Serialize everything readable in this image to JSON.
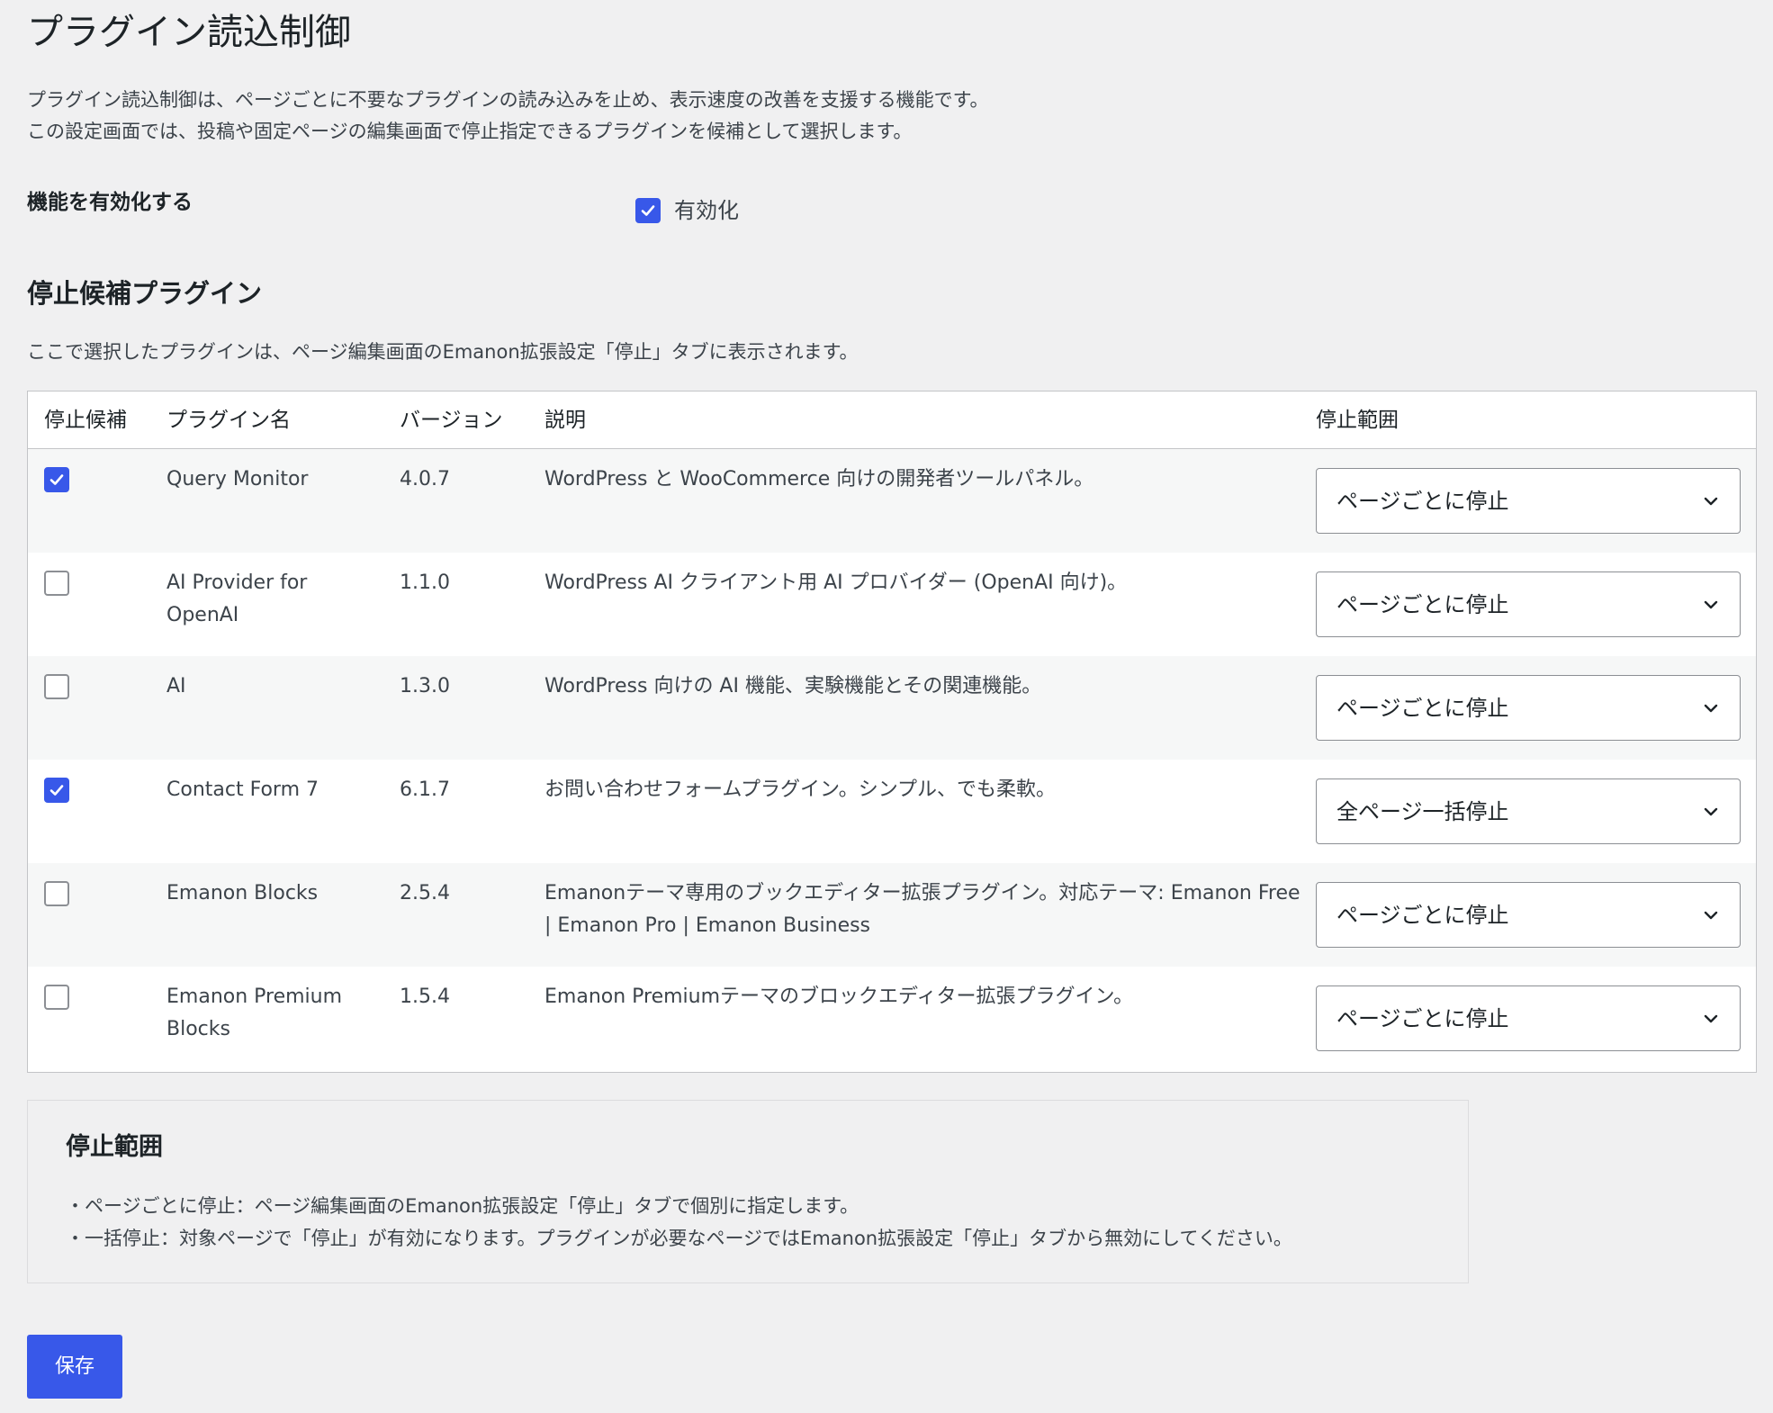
{
  "page": {
    "title": "プラグイン読込制御",
    "intro_line1": "プラグイン読込制御は、ページごとに不要なプラグインの読み込みを止め、表示速度の改善を支援する機能です。",
    "intro_line2": "この設定画面では、投稿や固定ページの編集画面で停止指定できるプラグインを候補として選択します。"
  },
  "enable": {
    "label": "機能を有効化する",
    "checkbox_label": "有効化",
    "checked": true
  },
  "candidates": {
    "heading": "停止候補プラグイン",
    "description": "ここで選択したプラグインは、ページ編集画面のEmanon拡張設定「停止」タブに表示されます。"
  },
  "table": {
    "headers": {
      "candidate": "停止候補",
      "name": "プラグイン名",
      "version": "バージョン",
      "description": "説明",
      "scope": "停止範囲"
    },
    "rows": [
      {
        "checked": true,
        "name": "Query Monitor",
        "version": "4.0.7",
        "description": "WordPress と WooCommerce 向けの開発者ツールパネル。",
        "scope": "ページごとに停止"
      },
      {
        "checked": false,
        "name": "AI Provider for OpenAI",
        "version": "1.1.0",
        "description": "WordPress AI クライアント用 AI プロバイダー (OpenAI 向け)。",
        "scope": "ページごとに停止"
      },
      {
        "checked": false,
        "name": "AI",
        "version": "1.3.0",
        "description": "WordPress 向けの AI 機能、実験機能とその関連機能。",
        "scope": "ページごとに停止"
      },
      {
        "checked": true,
        "name": "Contact Form 7",
        "version": "6.1.7",
        "description": "お問い合わせフォームプラグイン。シンプル、でも柔軟。",
        "scope": "全ページ一括停止"
      },
      {
        "checked": false,
        "name": "Emanon Blocks",
        "version": "2.5.4",
        "description": "Emanonテーマ専用のブックエディター拡張プラグイン。対応テーマ: Emanon Free | Emanon Pro | Emanon Business",
        "scope": "ページごとに停止"
      },
      {
        "checked": false,
        "name": "Emanon Premium Blocks",
        "version": "1.5.4",
        "description": "Emanon Premiumテーマのブロックエディター拡張プラグイン。",
        "scope": "ページごとに停止"
      }
    ]
  },
  "notice": {
    "heading": "停止範囲",
    "line1": "・ページごとに停止：ページ編集画面のEmanon拡張設定「停止」タブで個別に指定します。",
    "line2": "・一括停止：対象ページで「停止」が有効になります。プラグインが必要なページではEmanon拡張設定「停止」タブから無効にしてください。"
  },
  "actions": {
    "save_label": "保存"
  },
  "icons": {
    "checkbox_checked": "check-icon",
    "select_arrow": "chevron-down-icon"
  },
  "colors": {
    "accent": "#3858e9",
    "background": "#f0f0f1",
    "text": "#1d2327",
    "row_stripe": "#f6f7f7"
  }
}
